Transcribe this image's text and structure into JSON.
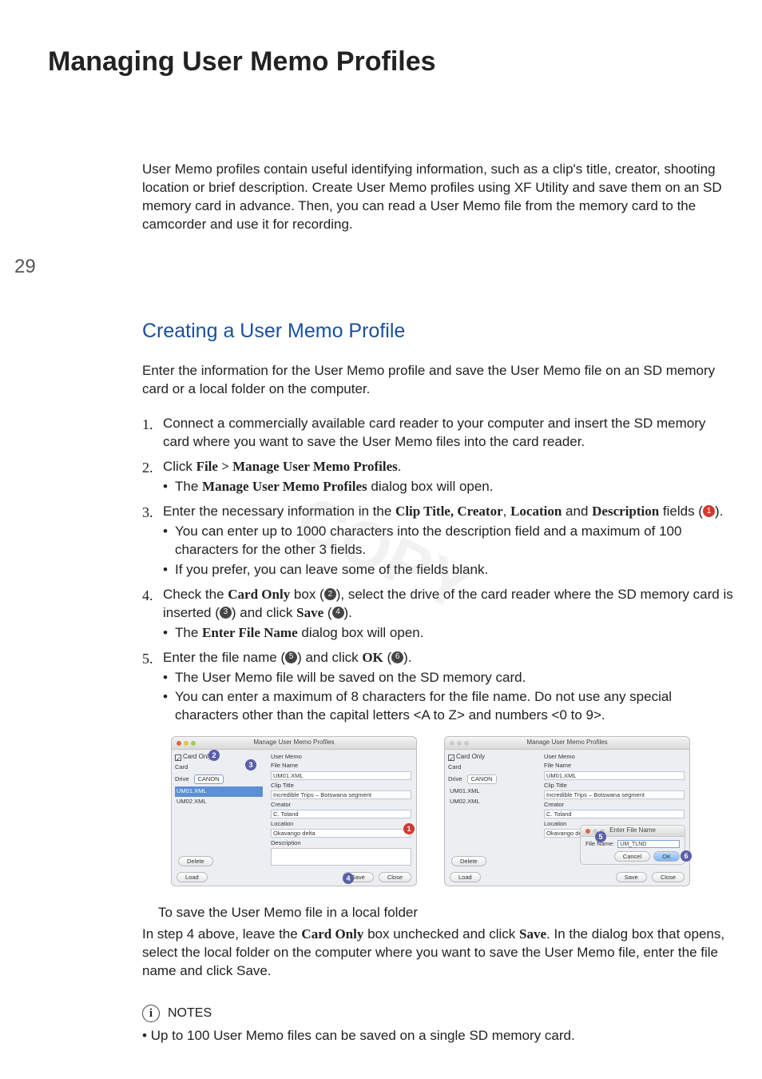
{
  "page_number": "29",
  "title": "Managing User Memo Profiles",
  "intro": "User Memo profiles contain useful identifying information, such as a clip's title, creator, shooting location or brief description. Create User Memo profiles using XF Utility and save them on an SD memory card in advance. Then, you can read a User Memo file from the memory card to the camcorder and use it for recording.",
  "section_title": "Creating a User Memo Profile",
  "section_intro": "Enter the information for the User Memo profile and save the User Memo file on an SD memory card or a local folder on the computer.",
  "steps": {
    "s1": "Connect a commercially available card reader to your computer and insert the SD memory card where you want to save the User Memo files into the card reader.",
    "s2_pre": "Click ",
    "s2_bold": "File > Manage User Memo Profiles",
    "s2_post": ".",
    "s2_b1_pre": "The ",
    "s2_b1_bold": "Manage User Memo Profiles",
    "s2_b1_post": " dialog box will open.",
    "s3_pre": "Enter the necessary information in the ",
    "s3_b1": "Clip Title, Creator",
    "s3_mid": ", ",
    "s3_b2": "Location",
    "s3_mid2": " and ",
    "s3_b3": "Description",
    "s3_post": " fields (",
    "s3_end": ").",
    "s3_sub1": "You can enter up to 1000 characters into the description field and a maximum of 100 characters for the other 3 fields.",
    "s3_sub2": "If you prefer, you can leave some of the fields blank.",
    "s4_pre": "Check the ",
    "s4_b1": "Card Only",
    "s4_mid1": " box (",
    "s4_mid2": "), select the drive of the card reader where the SD memory card is inserted (",
    "s4_mid3": ") and click ",
    "s4_b2": "Save",
    "s4_mid4": " (",
    "s4_end": ").",
    "s4_sub_pre": "The ",
    "s4_sub_b": "Enter File Name",
    "s4_sub_post": " dialog box will open.",
    "s5_pre": "Enter the file name (",
    "s5_mid1": ") and click ",
    "s5_b1": "OK",
    "s5_mid2": " (",
    "s5_end": ").",
    "s5_sub1": "The User Memo file will be saved on the SD memory card.",
    "s5_sub2": "You can enter a maximum of 8 characters for the file name. Do not use any special characters other than the capital letters <A to Z> and numbers <0 to 9>."
  },
  "fig": {
    "dialog_title": "Manage User Memo Profiles",
    "card_only": "Card Only",
    "card": "Card",
    "drive": "Drive",
    "drive_val": "CANON",
    "files": [
      "UM01.XML",
      "UM02.XML"
    ],
    "user_memo": "User Memo",
    "file_name_lbl": "File Name",
    "file_name_val": "UM01.XML",
    "clip_title_lbl": "Clip Title",
    "clip_title_val": "Incredible Trips – Botswana segment",
    "creator_lbl": "Creator",
    "creator_val": "C. Toland",
    "location_lbl": "Location",
    "location_val": "Okavango delta",
    "description_lbl": "Description",
    "delete": "Delete",
    "load": "Load",
    "save": "Save",
    "close": "Close",
    "modal_title": "Enter File Name",
    "modal_label": "File Name:",
    "modal_value": "UM_TLND",
    "cancel": "Cancel",
    "ok": "OK"
  },
  "local": {
    "heading": "To save the User Memo file in a local folder",
    "p_pre": "In step 4 above, leave the ",
    "p_b1": "Card Only",
    "p_mid1": " box unchecked and click ",
    "p_b2": "Save",
    "p_post": ". In the dialog box that opens, select the local folder on the computer where you want to save the User Memo file, enter the file name and click Save."
  },
  "notes_label": "NOTES",
  "notes_item": "Up to 100 User Memo files can be saved on a single SD memory card.",
  "watermark": "COPY"
}
